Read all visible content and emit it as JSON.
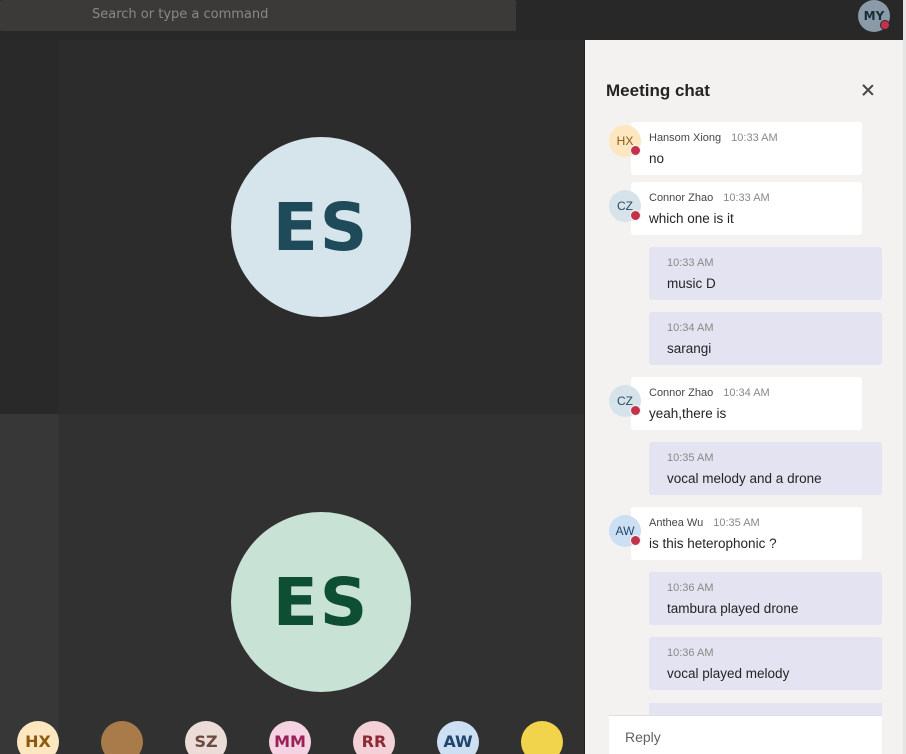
{
  "topbar": {
    "search_placeholder": "Search or type a command",
    "me_initials": "MY"
  },
  "stage": {
    "tile_top_initials": "ES",
    "tile_bottom_initials": "ES"
  },
  "roster": [
    {
      "initials": "HX",
      "bg": "#fde7c0",
      "fg": "#8a5a12"
    },
    {
      "initials": "",
      "bg": "#a97a4a",
      "fg": "#ffffff",
      "photo": true
    },
    {
      "initials": "SZ",
      "bg": "#ecdcd7",
      "fg": "#6b4a42"
    },
    {
      "initials": "MM",
      "bg": "#f6d3e2",
      "fg": "#9b2159"
    },
    {
      "initials": "RR",
      "bg": "#f3d1d6",
      "fg": "#8e2a36"
    },
    {
      "initials": "AW",
      "bg": "#cddff2",
      "fg": "#20466e"
    },
    {
      "initials": "",
      "bg": "#f1d44b",
      "fg": "#ffffff",
      "photo": true
    }
  ],
  "chat": {
    "title": "Meeting chat",
    "reply_placeholder": "Reply",
    "messages": [
      {
        "author": "Hansom Xiong",
        "initials": "HX",
        "time": "10:33 AM",
        "text": "no",
        "self": false,
        "av_bg": "#fde7c0",
        "av_fg": "#8a5a12"
      },
      {
        "author": "Connor Zhao",
        "initials": "CZ",
        "time": "10:33 AM",
        "text": "which one is it",
        "self": false,
        "av_bg": "#d7e3ea",
        "av_fg": "#2c4a5a"
      },
      {
        "author": "",
        "time": "10:33 AM",
        "text": "music D",
        "self": true
      },
      {
        "author": "",
        "time": "10:34 AM",
        "text": "sarangi",
        "self": true
      },
      {
        "author": "Connor Zhao",
        "initials": "CZ",
        "time": "10:34 AM",
        "text": "yeah,there is",
        "self": false,
        "av_bg": "#d7e3ea",
        "av_fg": "#2c4a5a"
      },
      {
        "author": "",
        "time": "10:35 AM",
        "text": "vocal melody and a drone",
        "self": true
      },
      {
        "author": "Anthea Wu",
        "initials": "AW",
        "time": "10:35 AM",
        "text": "is this heterophonic ?",
        "self": false,
        "av_bg": "#cddff2",
        "av_fg": "#20466e"
      },
      {
        "author": "",
        "time": "10:36 AM",
        "text": "tambura played drone",
        "self": true
      },
      {
        "author": "",
        "time": "10:36 AM",
        "text": "vocal played melody",
        "self": true
      }
    ]
  }
}
